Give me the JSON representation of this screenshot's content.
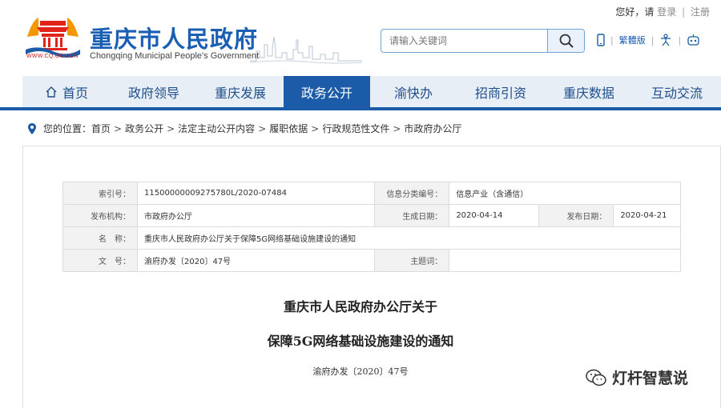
{
  "top": {
    "greeting": "您好，请",
    "login": "登录",
    "register": "注册",
    "separator": "|"
  },
  "header": {
    "url": "WWW.CQ.GOV.CN",
    "title_cn": "重庆市人民政府",
    "title_en": "Chongqing Municipal People's Government"
  },
  "search": {
    "placeholder": "请输入关键词"
  },
  "tools": {
    "traditional": "繁體版"
  },
  "nav": {
    "items": [
      {
        "label": "首页"
      },
      {
        "label": "政府领导"
      },
      {
        "label": "重庆发展"
      },
      {
        "label": "政务公开"
      },
      {
        "label": "渝快办"
      },
      {
        "label": "招商引资"
      },
      {
        "label": "重庆数据"
      },
      {
        "label": "互动交流"
      }
    ],
    "active_index": 3
  },
  "breadcrumb": {
    "prefix": "您的位置：",
    "items": [
      "首页",
      "政务公开",
      "法定主动公开内容",
      "履职依据",
      "行政规范性文件",
      "市政府办公厅"
    ],
    "sep": ">"
  },
  "meta": {
    "index_key": "索引号：",
    "index_val": "11500000009275780L/2020-07484",
    "category_key": "信息分类编号：",
    "category_val": "信息产业（含通信）",
    "publisher_key": "发布机构：",
    "publisher_val": "市政府办公厅",
    "created_key": "生成日期：",
    "created_val": "2020-04-14",
    "published_key": "发布日期：",
    "published_val": "2020-04-21",
    "name_key": "名　称：",
    "name_val": "重庆市人民政府办公厅关于保障5G网络基础设施建设的通知",
    "docno_key": "文　号：",
    "docno_val": "渝府办发〔2020〕47号",
    "topic_key": "主题词：",
    "topic_val": ""
  },
  "doc": {
    "title_line1": "重庆市人民政府办公厅关于",
    "title_line2": "保障5G网络基础设施建设的通知",
    "number": "渝府办发〔2020〕47号"
  },
  "watermark": {
    "text": "灯杆智慧说"
  },
  "colors": {
    "brand_blue": "#1b5ba8",
    "nav_bg": "#e8eef6",
    "logo_red": "#e2231a",
    "logo_orange": "#f39800"
  }
}
